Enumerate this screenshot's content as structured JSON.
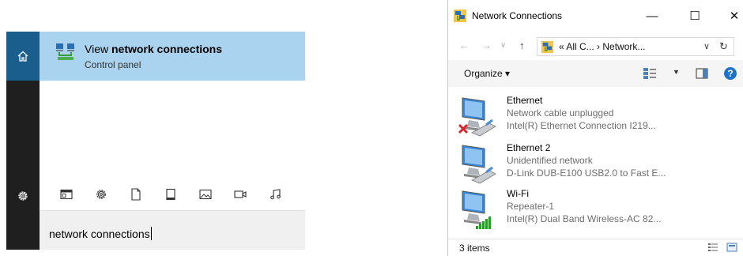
{
  "search_panel": {
    "best_match": {
      "title_prefix": "View ",
      "title_bold": "network connections",
      "subtitle": "Control panel"
    },
    "filters": [
      "apps-icon",
      "settings-icon",
      "documents-icon",
      "folders-icon",
      "photos-icon",
      "videos-icon",
      "music-icon"
    ],
    "query": "network connections",
    "colors": {
      "highlight": "#a9d3ee",
      "rail": "#1f1f1f",
      "home_active": "#1a5e8e"
    }
  },
  "network_window": {
    "title": "Network Connections",
    "controls": {
      "minimize": "—",
      "maximize": "☐",
      "close": "✕"
    },
    "address": {
      "path": "« All C...  ›  Network...",
      "dropdown": "∨",
      "refresh": "↻"
    },
    "nav": {
      "back": "←",
      "forward": "→",
      "recent": "∨",
      "up": "↑"
    },
    "toolbar": {
      "organize": "Organize ▾",
      "view_dropdown": "▼",
      "help": "?"
    },
    "connections": [
      {
        "name": "Ethernet",
        "status": "Network cable unplugged",
        "device": "Intel(R) Ethernet Connection I219...",
        "indicator": "unplugged-x-icon"
      },
      {
        "name": "Ethernet 2",
        "status": "Unidentified network",
        "device": "D-Link DUB-E100 USB2.0 to Fast E...",
        "indicator": "cable-icon"
      },
      {
        "name": "Wi-Fi",
        "status": "Repeater-1",
        "device": "Intel(R) Dual Band Wireless-AC 82...",
        "indicator": "signal-bars-icon"
      }
    ],
    "status": {
      "count": "3 items"
    }
  }
}
